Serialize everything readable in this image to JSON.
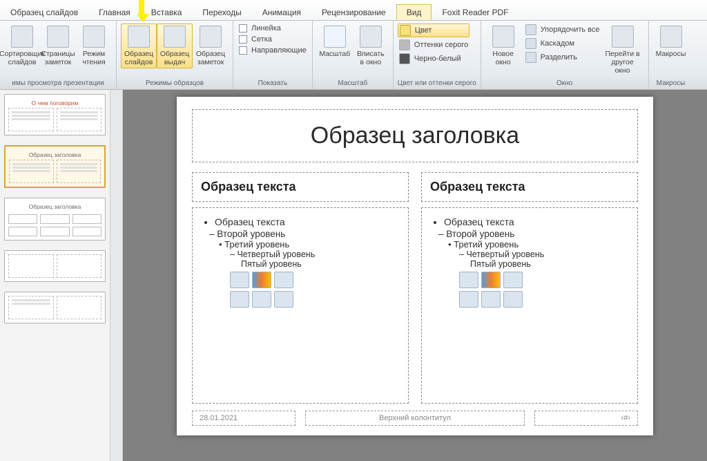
{
  "tabs": {
    "master": "Образец слайдов",
    "home": "Главная",
    "insert": "Вставка",
    "transitions": "Переходы",
    "animation": "Анимация",
    "review": "Рецензирование",
    "view": "Вид",
    "foxit": "Foxit Reader PDF"
  },
  "groups": {
    "pres_views": "имы просмотра презентации",
    "master_views": "Режимы образцов",
    "show": "Показать",
    "zoom": "Масштаб",
    "color": "Цвет или оттенки серого",
    "window": "Окно",
    "macros": "Макросы"
  },
  "btns": {
    "slide_sorter1": "Сортировщик",
    "slide_sorter2": "слайдов",
    "notes1": "Страницы",
    "notes2": "заметок",
    "reading1": "Режим",
    "reading2": "чтения",
    "slide_master1": "Образец",
    "slide_master2": "слайдов",
    "handout1": "Образец",
    "handout2": "выдач",
    "notes_master1": "Образец",
    "notes_master2": "заметок",
    "ruler": "Линейка",
    "grid": "Сетка",
    "guides": "Направляющие",
    "zoom": "Масштаб",
    "fit1": "Вписать",
    "fit2": "в окно",
    "color_full": "Цвет",
    "gray": "Оттенки серого",
    "bw": "Черно-белый",
    "new_win1": "Новое",
    "new_win2": "окно",
    "arrange": "Упорядочить все",
    "cascade": "Каскадом",
    "split": "Разделить",
    "switch1": "Перейти в",
    "switch2": "другое окно",
    "macros": "Макросы"
  },
  "thumbs": {
    "t1": "О чем поговорим",
    "t2": "Образец заголовка",
    "t3": "Образец заголовка"
  },
  "slide": {
    "title": "Образец заголовка",
    "heading": "Образец текста",
    "lvl1": "Образец текста",
    "lvl2": "Второй уровень",
    "lvl3": "Третий уровень",
    "lvl4": "Четвертый уровень",
    "lvl5": "Пятый уровень",
    "date": "28.01.2021",
    "footer": "Верхний колонтитул",
    "num": "‹#›"
  }
}
